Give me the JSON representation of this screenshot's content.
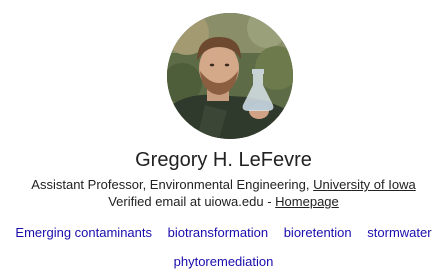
{
  "profile": {
    "name": "Gregory H. LeFevre",
    "affiliation_prefix": "Assistant Professor, Environmental Engineering, ",
    "institution": "University of Iowa",
    "verified_prefix": "Verified email at uiowa.edu - ",
    "homepage_label": "Homepage"
  },
  "interests": [
    "Emerging contaminants",
    "biotransformation",
    "bioretention",
    "stormwater",
    "phytoremediation"
  ],
  "colors": {
    "text": "#222222",
    "link": "#1a0dab"
  }
}
